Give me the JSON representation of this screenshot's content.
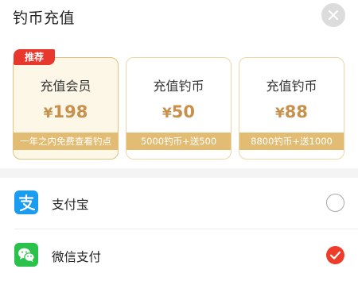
{
  "header": {
    "title": "钓币充值",
    "close_icon": "close-icon"
  },
  "plans": [
    {
      "name": "充值会员",
      "currency": "¥",
      "amount": "198",
      "desc": "一年之内免费查看钓点",
      "badge": "推荐",
      "selected": true
    },
    {
      "name": "充值钓币",
      "currency": "¥",
      "amount": "50",
      "desc": "5000钓币+送500",
      "selected": false
    },
    {
      "name": "充值钓币",
      "currency": "¥",
      "amount": "88",
      "desc": "8800钓币+送1000",
      "selected": false
    }
  ],
  "payment_methods": [
    {
      "label": "支付宝",
      "icon": "alipay-icon",
      "checked": false
    },
    {
      "label": "微信支付",
      "icon": "wechat-pay-icon",
      "checked": true
    }
  ],
  "colors": {
    "accent_gold": "#c8904a",
    "desc_band": "#e2bc72",
    "badge_red": "#e8372c",
    "check_red": "#ee3b2a",
    "alipay_blue": "#1a9cf0",
    "wechat_green": "#2bc24c"
  }
}
